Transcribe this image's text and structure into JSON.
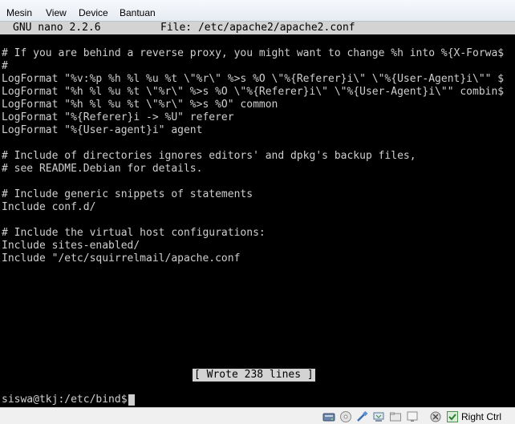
{
  "menu": {
    "items": [
      {
        "label": "Mesin"
      },
      {
        "label": "View"
      },
      {
        "label": "Device"
      },
      {
        "label": "Bantuan"
      }
    ]
  },
  "nano": {
    "version": "GNU nano 2.2.6",
    "file": "File: /etc/apache2/apache2.conf"
  },
  "editor": {
    "lines": [
      "",
      "# If you are behind a reverse proxy, you might want to change %h into %{X-Forwa$",
      "#",
      "LogFormat \"%v:%p %h %l %u %t \\\"%r\\\" %>s %O \\\"%{Referer}i\\\" \\\"%{User-Agent}i\\\"\" $",
      "LogFormat \"%h %l %u %t \\\"%r\\\" %>s %O \\\"%{Referer}i\\\" \\\"%{User-Agent}i\\\"\" combin$",
      "LogFormat \"%h %l %u %t \\\"%r\\\" %>s %O\" common",
      "LogFormat \"%{Referer}i -> %U\" referer",
      "LogFormat \"%{User-agent}i\" agent",
      "",
      "# Include of directories ignores editors' and dpkg's backup files,",
      "# see README.Debian for details.",
      "",
      "# Include generic snippets of statements",
      "Include conf.d/",
      "",
      "# Include the virtual host configurations:",
      "Include sites-enabled/",
      "Include \"/etc/squirrelmail/apache.conf"
    ]
  },
  "status": {
    "message": "[ Wrote 238 lines ]"
  },
  "shell": {
    "prompt": "siswa@tkj:/etc/bind$"
  },
  "vbox_status": {
    "host_key_label": "Right Ctrl",
    "icons": [
      "hard-disk-icon",
      "optical-drive-icon",
      "usb-icon",
      "network-icon",
      "shared-folder-icon",
      "display-icon",
      "capture-icon",
      "mouse-integration-icon"
    ]
  }
}
